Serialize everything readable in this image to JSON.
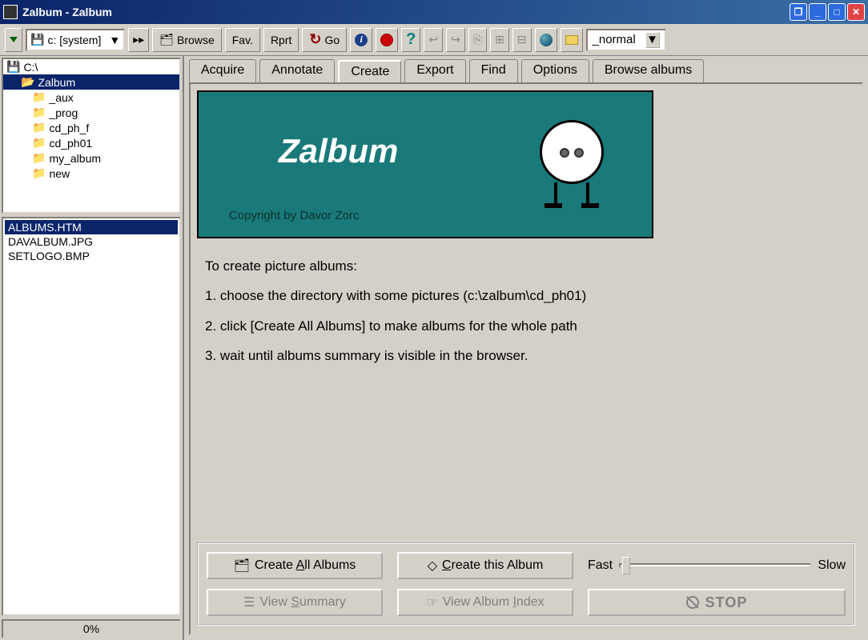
{
  "window": {
    "title": "Zalbum - Zalbum"
  },
  "toolbar": {
    "drive": "c: [system]",
    "browse": "Browse",
    "fav": "Fav.",
    "rprt": "Rprt",
    "go": "Go",
    "normal": "_normal"
  },
  "tree": {
    "root": "C:\\",
    "items": [
      "Zalbum",
      "_aux",
      "_prog",
      "cd_ph_f",
      "cd_ph01",
      "my_album",
      "new"
    ],
    "selected": 0
  },
  "files": {
    "items": [
      "ALBUMS.HTM",
      "DAVALBUM.JPG",
      "SETLOGO.BMP"
    ],
    "selected": 0
  },
  "progress": "0%",
  "tabs": {
    "items": [
      "Acquire",
      "Annotate",
      "Create",
      "Export",
      "Find",
      "Options",
      "Browse albums"
    ],
    "active": 2
  },
  "banner": {
    "title": "Zalbum",
    "copyright": "Copyright by Davor Zorc"
  },
  "instructions": {
    "heading": "To create picture albums:",
    "step1": "1. choose the directory with some pictures (c:\\zalbum\\cd_ph01)",
    "step2": "2. click [Create All Albums] to make albums for the whole path",
    "step3": "3. wait until albums summary is visible in the browser."
  },
  "actions": {
    "create_all": "Create All Albums",
    "create_this": "Create this Album",
    "view_summary": "View Summary",
    "view_index": "View Album Index",
    "fast": "Fast",
    "slow": "Slow",
    "stop": "STOP"
  }
}
